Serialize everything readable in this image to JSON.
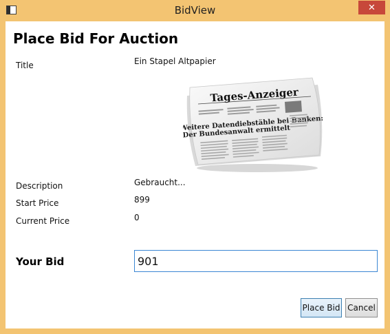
{
  "window": {
    "title": "BidView",
    "close_glyph": "✕"
  },
  "page": {
    "heading": "Place Bid For Auction"
  },
  "item": {
    "title_label": "Title",
    "title_value": "Ein Stapel Altpapier",
    "image": {
      "masthead": "Tages-Anzeiger",
      "headline_1": "Weitere Datendiebstähle bei Banken:",
      "headline_2": "Der Bundesanwalt ermittelt"
    },
    "description_label": "Description",
    "description_value": "Gebraucht...",
    "start_price_label": "Start Price",
    "start_price_value": "899",
    "current_price_label": "Current Price",
    "current_price_value": "0"
  },
  "bid": {
    "label": "Your Bid",
    "value": "901"
  },
  "buttons": {
    "place_bid": "Place Bid",
    "cancel": "Cancel"
  },
  "colors": {
    "frame": "#f3c472",
    "close": "#c7483a",
    "input_border": "#3a86d3"
  }
}
